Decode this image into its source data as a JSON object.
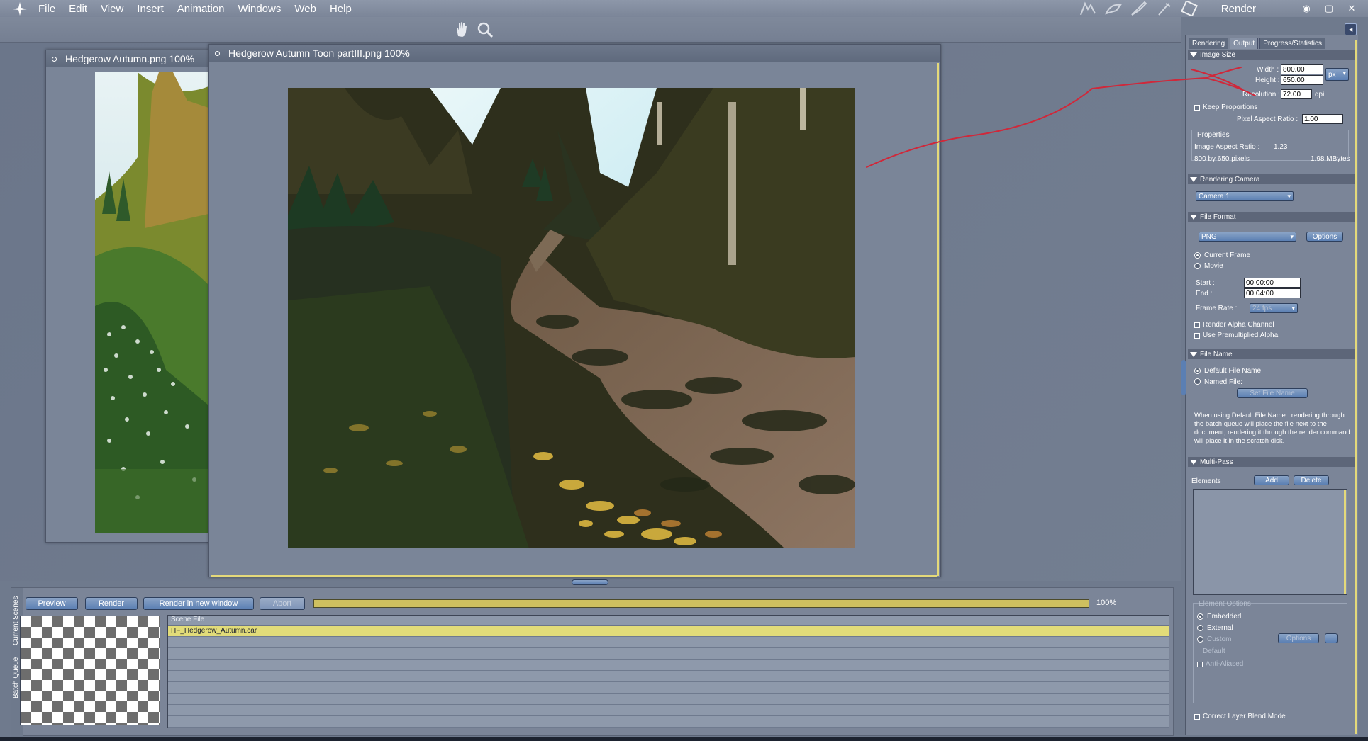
{
  "menubar": {
    "items": [
      "File",
      "Edit",
      "View",
      "Insert",
      "Animation",
      "Windows",
      "Web",
      "Help"
    ],
    "right_title": "Render"
  },
  "documents": {
    "back": {
      "title": "Hedgerow Autumn.png 100%"
    },
    "front": {
      "title": "Hedgerow Autumn Toon partIII.png 100%"
    }
  },
  "batch": {
    "side_tabs": [
      "Current Scenes",
      "Batch Queue"
    ],
    "buttons": {
      "preview": "Preview",
      "render": "Render",
      "render_new": "Render in new window",
      "abort": "Abort"
    },
    "progress_percent": "100%",
    "progress_fraction": 1.0,
    "table_header": "Scene File",
    "rows": [
      "HF_Hedgerow_Autumn.car",
      "",
      "",
      "",
      "",
      "",
      "",
      "",
      ""
    ]
  },
  "render_panel": {
    "tabs": [
      "Rendering",
      "Output",
      "Progress/Statistics"
    ],
    "image_size": {
      "header": "Image Size",
      "width_label": "Width :",
      "width_value": "800.00",
      "height_label": "Height :",
      "height_value": "650.00",
      "unit": "px",
      "resolution_label": "Resolution :",
      "resolution_value": "72.00",
      "resolution_unit": "dpi",
      "keep_proportions": "Keep Proportions",
      "pixel_aspect_label": "Pixel Aspect Ratio :",
      "pixel_aspect_value": "1.00",
      "properties_label": "Properties",
      "image_aspect_label": "Image Aspect Ratio :",
      "image_aspect_value": "1.23",
      "pixels_text": "800 by 650 pixels",
      "size_text": "1.98 MBytes"
    },
    "rendering_camera": {
      "header": "Rendering Camera",
      "camera": "Camera 1"
    },
    "file_format": {
      "header": "File Format",
      "format": "PNG",
      "options": "Options",
      "current_frame": "Current Frame",
      "movie": "Movie",
      "start_label": "Start :",
      "start_value": "00:00:00",
      "end_label": "End :",
      "end_value": "00:04:00",
      "frame_rate_label": "Frame Rate :",
      "frame_rate_value": "24 fps",
      "render_alpha": "Render Alpha Channel",
      "premultiplied": "Use Premultiplied Alpha"
    },
    "file_name": {
      "header": "File Name",
      "default_name": "Default File Name",
      "named_file": "Named File:",
      "set_file_name": "Set File Name",
      "info": "When using Default File Name : rendering through the batch queue will place the file next to the document, rendering it through the render command will place it in the scratch disk."
    },
    "multipass": {
      "header": "Multi-Pass",
      "elements_label": "Elements",
      "add": "Add",
      "delete": "Delete",
      "element_options": "Element Options",
      "embedded": "Embedded",
      "external": "External",
      "custom": "Custom",
      "options": "Options",
      "default_label": "Default",
      "anti_aliased": "Anti-Aliased",
      "correct_blend": "Correct Layer Blend Mode"
    }
  },
  "colors": {
    "accent_yellow": "#e2dc79",
    "button_blue": "#5b7fb3",
    "annotation_red": "#d0283a"
  }
}
